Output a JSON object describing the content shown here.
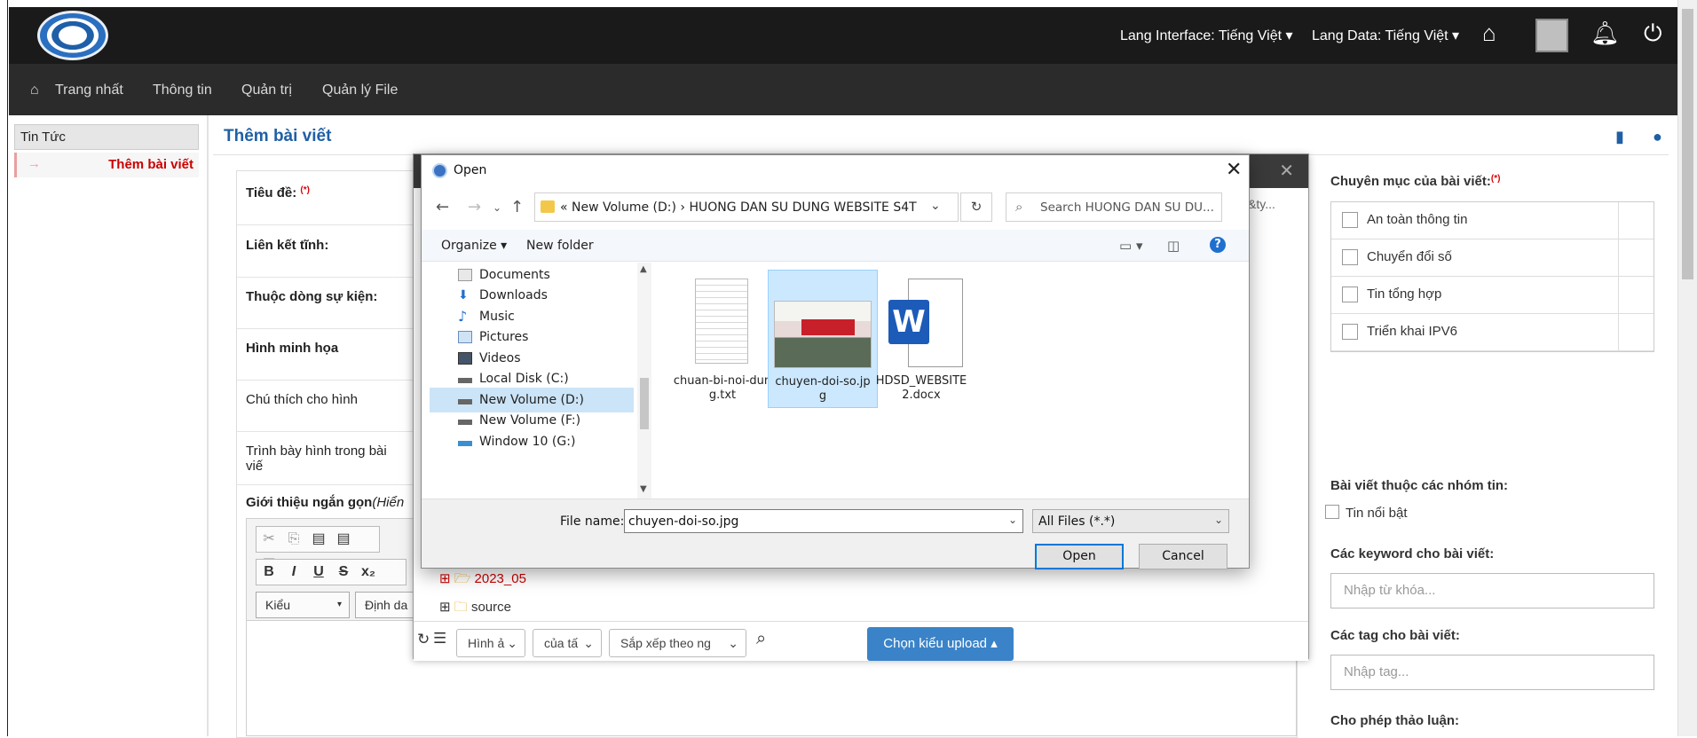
{
  "header": {
    "lang_interface": "Lang Interface: Tiếng Việt ▾",
    "lang_data": "Lang Data: Tiếng Việt ▾"
  },
  "nav": {
    "home": "Trang nhất",
    "info": "Thông tin",
    "admin": "Quản trị",
    "files": "Quản lý File"
  },
  "sidebar": {
    "heading": "Tin Tức",
    "active_item": "Thêm bài viết",
    "arrow": "→"
  },
  "page": {
    "title": "Thêm bài viết"
  },
  "form": {
    "title_label": "Tiêu đề",
    "required_mark": "(*)",
    "static_link_label": "Liên kết tĩnh:",
    "event_stream_label": "Thuộc dòng sự kiện:",
    "image_label": "Hình minh họa",
    "caption_label": "Chú thích cho hình",
    "layout_label": "Trình bày hình trong bài viế",
    "intro_label": "Giới thiệu ngắn gọn",
    "intro_hint": "(Hiển",
    "style_select": "Kiểu",
    "format_select": "Định da"
  },
  "right_panel": {
    "categories_label": "Chuyên mục của bài viết:",
    "categories": [
      "An toàn thông tin",
      "Chuyển đổi số",
      "Tin tổng hợp",
      "Triển khai IPV6"
    ],
    "groups_label": "Bài viết thuộc các nhóm tin:",
    "featured_label": "Tin nổi bật",
    "keywords_label": "Các keyword cho bài viết:",
    "keywords_placeholder": "Nhập từ khóa...",
    "tags_label": "Các tag cho bài viết:",
    "tags_placeholder": "Nhập tag...",
    "discussion_label": "Cho phép thảo luận:"
  },
  "file_manager": {
    "header_fragment": "&ty...",
    "folder_2023": "2023_05",
    "folder_source": "source",
    "filter_type": "Hình ả",
    "filter_owner": "của tấ",
    "sort": "Sắp xếp theo ng",
    "upload_button": "Chọn kiểu upload ▴"
  },
  "open_dialog": {
    "title": "Open",
    "address": "«  New Volume (D:)  ›  HUONG DAN SU DUNG WEBSITE S4T",
    "search_placeholder": "Search HUONG DAN SU DU...",
    "organize": "Organize ▾",
    "new_folder": "New folder",
    "nav_items": [
      "Documents",
      "Downloads",
      "Music",
      "Pictures",
      "Videos",
      "Local Disk (C:)",
      "New Volume (D:)",
      "New Volume (F:)",
      "Window 10 (G:)"
    ],
    "selected_nav": "New Volume (D:)",
    "files": [
      {
        "name": "chuan-bi-noi-dung.txt",
        "kind": "text"
      },
      {
        "name": "chuyen-doi-so.jpg",
        "kind": "image",
        "selected": true
      },
      {
        "name": "HDSD_WEBSITE2.docx",
        "kind": "word"
      }
    ],
    "file_name_label": "File name:",
    "file_name_value": "chuyen-doi-so.jpg",
    "file_type": "All Files (*.*)",
    "open_button": "Open",
    "cancel_button": "Cancel"
  }
}
